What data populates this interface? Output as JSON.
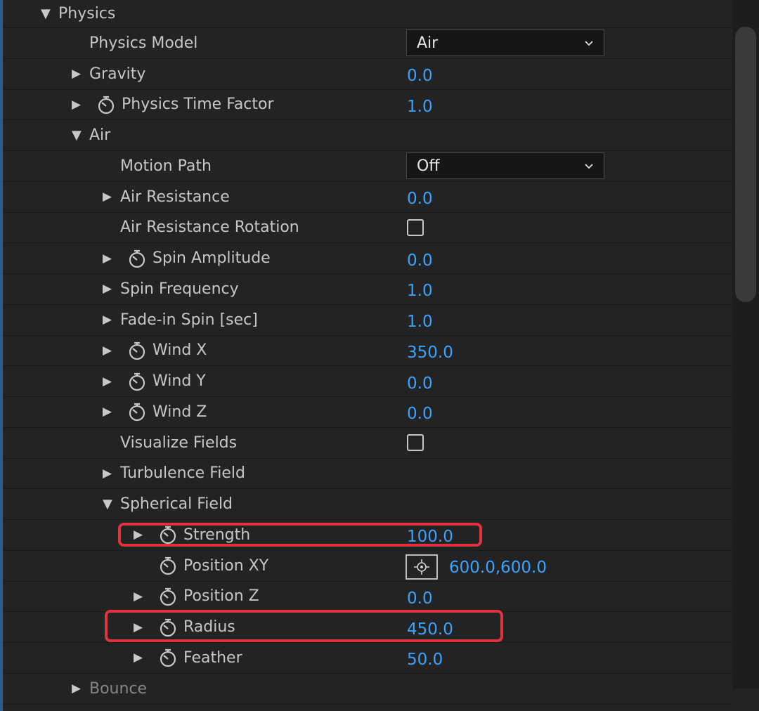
{
  "panel": {
    "rows": [
      {
        "id": "physics",
        "label": "Physics",
        "twirl": "expanded",
        "stopwatch": false,
        "control": "none"
      },
      {
        "id": "physics-model",
        "label": "Physics Model",
        "twirl": "none",
        "stopwatch": false,
        "control": "dropdown",
        "value": "Air"
      },
      {
        "id": "gravity",
        "label": "Gravity",
        "twirl": "collapsed",
        "stopwatch": false,
        "control": "number",
        "value": "0.0"
      },
      {
        "id": "physics-time-factor",
        "label": "Physics Time Factor",
        "twirl": "collapsed",
        "stopwatch": true,
        "control": "number",
        "value": "1.0"
      },
      {
        "id": "air",
        "label": "Air",
        "twirl": "expanded",
        "stopwatch": false,
        "control": "none"
      },
      {
        "id": "motion-path",
        "label": "Motion Path",
        "twirl": "none",
        "stopwatch": false,
        "control": "dropdown",
        "value": "Off"
      },
      {
        "id": "air-resistance",
        "label": "Air Resistance",
        "twirl": "collapsed",
        "stopwatch": false,
        "control": "number",
        "value": "0.0"
      },
      {
        "id": "air-resistance-rotation",
        "label": "Air Resistance Rotation",
        "twirl": "none",
        "stopwatch": false,
        "control": "checkbox",
        "checked": false
      },
      {
        "id": "spin-amplitude",
        "label": "Spin Amplitude",
        "twirl": "collapsed",
        "stopwatch": true,
        "control": "number",
        "value": "0.0"
      },
      {
        "id": "spin-frequency",
        "label": "Spin Frequency",
        "twirl": "collapsed",
        "stopwatch": false,
        "control": "number",
        "value": "1.0"
      },
      {
        "id": "fade-in-spin",
        "label": "Fade-in Spin [sec]",
        "twirl": "collapsed",
        "stopwatch": false,
        "control": "number",
        "value": "1.0"
      },
      {
        "id": "wind-x",
        "label": "Wind X",
        "twirl": "collapsed",
        "stopwatch": true,
        "control": "number",
        "value": "350.0"
      },
      {
        "id": "wind-y",
        "label": "Wind Y",
        "twirl": "collapsed",
        "stopwatch": true,
        "control": "number",
        "value": "0.0"
      },
      {
        "id": "wind-z",
        "label": "Wind Z",
        "twirl": "collapsed",
        "stopwatch": true,
        "control": "number",
        "value": "0.0"
      },
      {
        "id": "visualize-fields",
        "label": "Visualize Fields",
        "twirl": "none",
        "stopwatch": false,
        "control": "checkbox",
        "checked": false
      },
      {
        "id": "turbulence-field",
        "label": "Turbulence Field",
        "twirl": "collapsed",
        "stopwatch": false,
        "control": "none"
      },
      {
        "id": "spherical-field",
        "label": "Spherical Field",
        "twirl": "expanded",
        "stopwatch": false,
        "control": "none"
      },
      {
        "id": "strength",
        "label": "Strength",
        "twirl": "collapsed",
        "stopwatch": true,
        "control": "number",
        "value": "100.0",
        "highlighted": true
      },
      {
        "id": "position-xy",
        "label": "Position XY",
        "twirl": "none",
        "stopwatch": true,
        "control": "point",
        "value": "600.0,600.0"
      },
      {
        "id": "position-z",
        "label": "Position Z",
        "twirl": "collapsed",
        "stopwatch": true,
        "control": "number",
        "value": "0.0"
      },
      {
        "id": "radius",
        "label": "Radius",
        "twirl": "collapsed",
        "stopwatch": true,
        "control": "number",
        "value": "450.0",
        "highlighted": true
      },
      {
        "id": "feather",
        "label": "Feather",
        "twirl": "collapsed",
        "stopwatch": true,
        "control": "number",
        "value": "50.0"
      },
      {
        "id": "bounce",
        "label": "Bounce",
        "twirl": "collapsed",
        "stopwatch": false,
        "control": "none",
        "dim": true
      }
    ]
  },
  "colors": {
    "background": "#232323",
    "value_blue": "#3aa3ff",
    "label": "#c6c6c6",
    "highlight_red": "#e1323f"
  },
  "icons": {
    "expanded": "triangle-down-icon",
    "collapsed": "triangle-right-icon",
    "stopwatch": "stopwatch-icon",
    "dropdown": "chevron-down-icon",
    "point": "crosshair-icon"
  }
}
